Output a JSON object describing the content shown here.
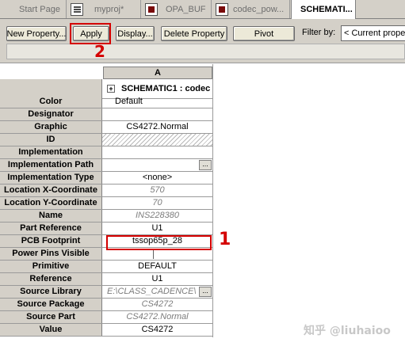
{
  "tabs": [
    {
      "label": "Start Page",
      "icon": "none",
      "active": false
    },
    {
      "label": "myproj*",
      "icon": "project-icon",
      "active": false
    },
    {
      "label": "OPA_BUF",
      "icon": "schematic-icon",
      "active": false
    },
    {
      "label": "codec_pow...",
      "icon": "schematic-icon",
      "active": false
    },
    {
      "label": "SCHEMATI...",
      "icon": "none",
      "active": true
    }
  ],
  "toolbar": {
    "new_property": "New Property...",
    "apply": "Apply",
    "display": "Display...",
    "delete_property": "Delete Property",
    "pivot": "Pivot",
    "filter_label": "Filter by:",
    "filter_value": "< Current proper"
  },
  "annotations": {
    "apply_marker": "2",
    "pcb_marker": "1"
  },
  "grid": {
    "column_header": "A",
    "part_title": "SCHEMATIC1 : codec",
    "expand_symbol": "+",
    "rows": [
      {
        "label": "Color",
        "value": "Default",
        "style": "normal"
      },
      {
        "label": "Designator",
        "value": "",
        "style": "normal"
      },
      {
        "label": "Graphic",
        "value": "CS4272.Normal",
        "style": "normal"
      },
      {
        "label": "ID",
        "value": "",
        "style": "hatch"
      },
      {
        "label": "Implementation",
        "value": "",
        "style": "normal"
      },
      {
        "label": "Implementation Path",
        "value": "",
        "style": "dots"
      },
      {
        "label": "Implementation Type",
        "value": "<none>",
        "style": "normal"
      },
      {
        "label": "Location X-Coordinate",
        "value": "570",
        "style": "gray"
      },
      {
        "label": "Location Y-Coordinate",
        "value": "70",
        "style": "gray"
      },
      {
        "label": "Name",
        "value": "INS228380",
        "style": "gray"
      },
      {
        "label": "Part Reference",
        "value": "U1",
        "style": "normal"
      },
      {
        "label": "PCB Footprint",
        "value": "tssop65p_28",
        "style": "normal"
      },
      {
        "label": "Power Pins Visible",
        "value": "",
        "style": "checkbox"
      },
      {
        "label": "Primitive",
        "value": "DEFAULT",
        "style": "normal"
      },
      {
        "label": "Reference",
        "value": "U1",
        "style": "normal"
      },
      {
        "label": "Source Library",
        "value": "E:\\CLASS_CADENCE\\",
        "style": "gray-dots"
      },
      {
        "label": "Source Package",
        "value": "CS4272",
        "style": "gray"
      },
      {
        "label": "Source Part",
        "value": "CS4272.Normal",
        "style": "gray"
      },
      {
        "label": "Value",
        "value": "CS4272",
        "style": "normal"
      }
    ]
  },
  "watermark": "知乎 @liuhaioo",
  "colors": {
    "accent_red": "#d40000",
    "panel": "#d4d0c8"
  }
}
